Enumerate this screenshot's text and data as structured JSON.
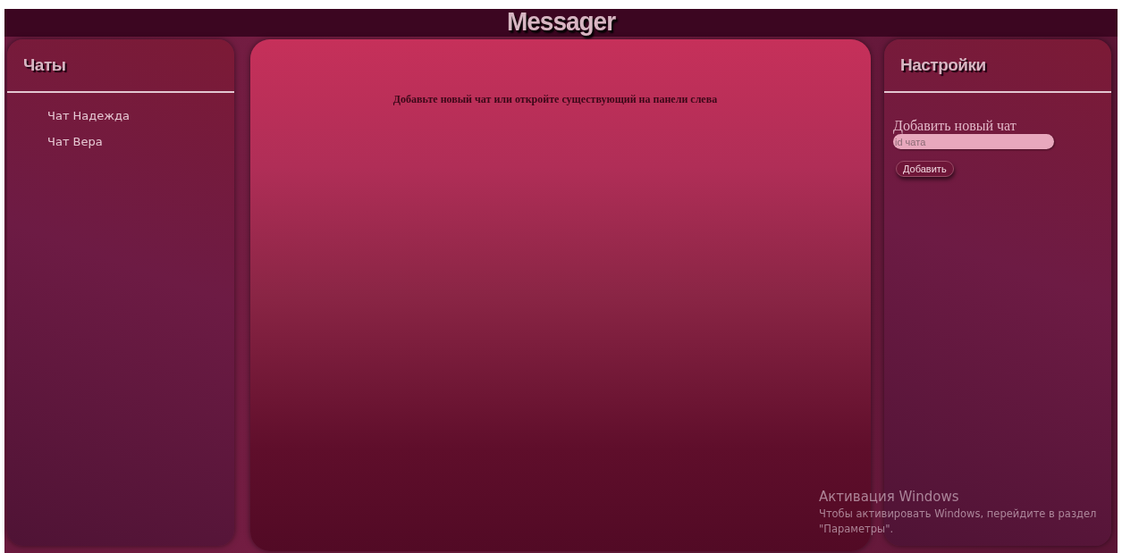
{
  "header": {
    "title": "Messager"
  },
  "chats_panel": {
    "title": "Чаты",
    "items": [
      {
        "label": "Чат Надежда"
      },
      {
        "label": "Чат Вера"
      }
    ]
  },
  "main": {
    "message": "Добавьте новый чат или откройте существующий на панели слева"
  },
  "settings_panel": {
    "title": "Настройки",
    "section_label": "Добавить новый чат",
    "input": {
      "placeholder": "id чата"
    },
    "button": "Добавить"
  },
  "activation_notice": {
    "title": "Активация Windows",
    "text": "Чтобы активировать Windows, перейдите в раздел \"Параметры\"."
  }
}
